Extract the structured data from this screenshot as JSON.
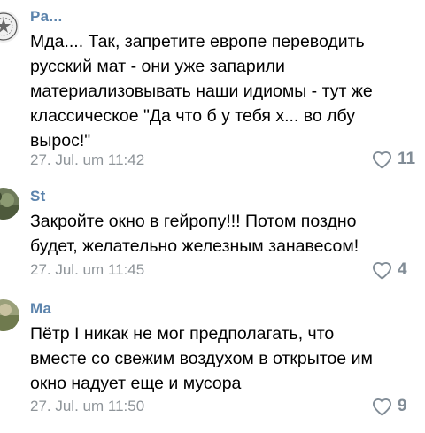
{
  "comments": [
    {
      "author": "Pa...",
      "text": "Мда.... Так, запретите европе переводить\nрусский мат - они уже запарили\nматериализовывать наши идиомы - тут же\nклассическое \"Да что б у тебя х... во лбу\nвырос!\"",
      "timestamp": "27. Jul. um 11:42",
      "likes": "11"
    },
    {
      "author": "St",
      "text": "Закройте окно в гейропу!!! Потом поздно\nбудет, желательно железным занавесом!",
      "timestamp": "27. Jul. um 11:45",
      "likes": "4"
    },
    {
      "author": "Ma",
      "text": "Пётр I никак не мог предполагать, что\nвместе со свежим воздухом в открытое им\nокно надует еще и мусора",
      "timestamp": "27. Jul. um 11:50",
      "likes": "9"
    }
  ],
  "colors": {
    "author": "#5b83ac",
    "meta": "#8e9499",
    "like_icon": "#818c96"
  },
  "icons": {
    "like": "heart-outline-icon"
  }
}
